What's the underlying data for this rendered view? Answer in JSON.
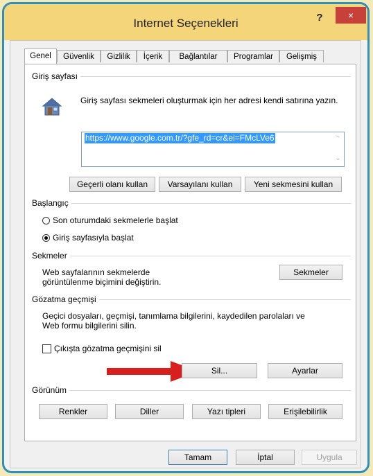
{
  "window": {
    "title": "Internet Seçenekleri",
    "help_label": "?",
    "close_label": "×"
  },
  "tabs": [
    {
      "label": "Genel"
    },
    {
      "label": "Güvenlik"
    },
    {
      "label": "Gizlilik"
    },
    {
      "label": "İçerik"
    },
    {
      "label": "Bağlantılar"
    },
    {
      "label": "Programlar"
    },
    {
      "label": "Gelişmiş"
    }
  ],
  "home": {
    "group_label": "Giriş sayfası",
    "description": "Giriş sayfası sekmeleri oluşturmak için her adresi kendi satırına yazın.",
    "url": "https://www.google.com.tr/?gfe_rd=cr&ei=FMcLVe6",
    "btn_current": "Geçerli olanı kullan",
    "btn_default": "Varsayılanı kullan",
    "btn_newtab": "Yeni sekmesini kullan"
  },
  "startup": {
    "group_label": "Başlangıç",
    "option_last": "Son oturumdaki sekmelerle başlat",
    "option_home": "Giriş sayfasıyla başlat",
    "selected": "option_home"
  },
  "tabs_group": {
    "group_label": "Sekmeler",
    "description": "Web sayfalarının sekmelerde görüntülenme biçimini değiştirin.",
    "btn_tabs": "Sekmeler"
  },
  "history": {
    "group_label": "Gözatma geçmişi",
    "description": "Geçici dosyaları, geçmişi, tanımlama bilgilerini, kaydedilen parolaları ve Web formu bilgilerini silin.",
    "checkbox_label": "Çıkışta gözatma geçmişini sil",
    "checkbox_checked": false,
    "btn_delete": "Sil...",
    "btn_settings": "Ayarlar"
  },
  "appearance": {
    "group_label": "Görünüm",
    "btn_colors": "Renkler",
    "btn_languages": "Diller",
    "btn_fonts": "Yazı tipleri",
    "btn_accessibility": "Erişilebilirlik"
  },
  "footer": {
    "ok": "Tamam",
    "cancel": "İptal",
    "apply": "Uygula"
  },
  "colors": {
    "accent": "#2d8fbd",
    "title_bg": "#f4d57a",
    "close_bg": "#c8403a",
    "arrow": "#d81f1f"
  }
}
